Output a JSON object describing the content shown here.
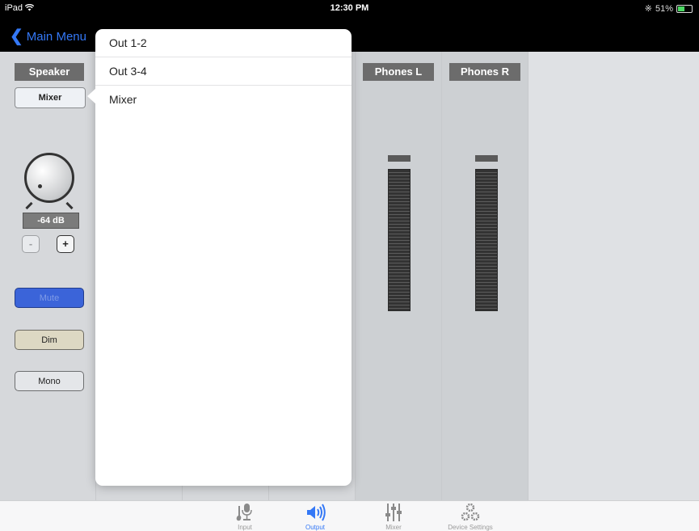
{
  "status_bar": {
    "device": "iPad",
    "time": "12:30 PM",
    "battery": "51%"
  },
  "nav": {
    "back_label": "Main Menu"
  },
  "channels": [
    {
      "label": "Speaker",
      "route": "Mixer",
      "volume": "-64 dB",
      "minus": "-",
      "plus": "+",
      "mute": "Mute",
      "dim": "Dim",
      "mono": "Mono"
    },
    {
      "label": "Phones L"
    },
    {
      "label": "Phones R"
    }
  ],
  "popover": {
    "items": [
      "Out 1-2",
      "Out 3-4",
      "Mixer"
    ]
  },
  "tabs": [
    {
      "label": "Input",
      "icon": "microphone-guitar-icon",
      "active": false
    },
    {
      "label": "Output",
      "icon": "speaker-icon",
      "active": true
    },
    {
      "label": "Mixer",
      "icon": "faders-icon",
      "active": false
    },
    {
      "label": "Device Settings",
      "icon": "gears-icon",
      "active": false
    }
  ],
  "colors": {
    "accent": "#3478f6",
    "mute_active": "#3b64d9",
    "label_bg": "#6c6c6c"
  }
}
